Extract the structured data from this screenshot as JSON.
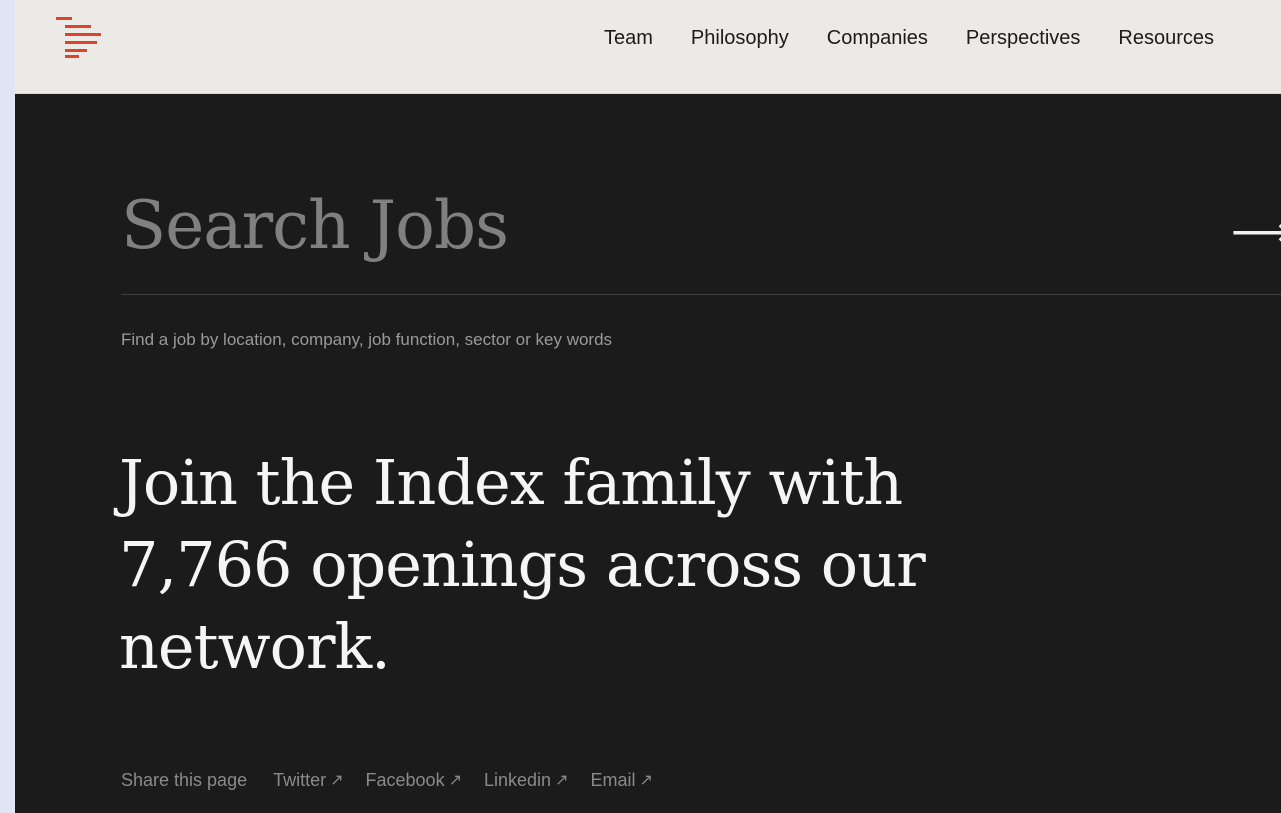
{
  "nav": {
    "logo_icon": "index-ventures-logo-icon",
    "items": [
      {
        "label": "Team"
      },
      {
        "label": "Philosophy"
      },
      {
        "label": "Companies"
      },
      {
        "label": "Perspectives"
      },
      {
        "label": "Resources"
      }
    ]
  },
  "search": {
    "title": "Search Jobs",
    "submit_icon": "arrow-right-icon",
    "submit_glyph": "⟶",
    "hint": "Find a job by location, company, job function, sector or key words"
  },
  "headline": {
    "line1": "Join the Index family with",
    "line2": "7,766 openings across our",
    "line3": "network."
  },
  "share": {
    "label": "Share this page",
    "external_icon": "external-link-arrow-icon",
    "external_glyph": "↗",
    "links": [
      {
        "label": "Twitter"
      },
      {
        "label": "Facebook"
      },
      {
        "label": "Linkedin"
      },
      {
        "label": "Email"
      }
    ]
  },
  "colors": {
    "accent": "#e0432c",
    "nav_bg": "#ebeae6",
    "page_bg": "#1b1b1b"
  }
}
